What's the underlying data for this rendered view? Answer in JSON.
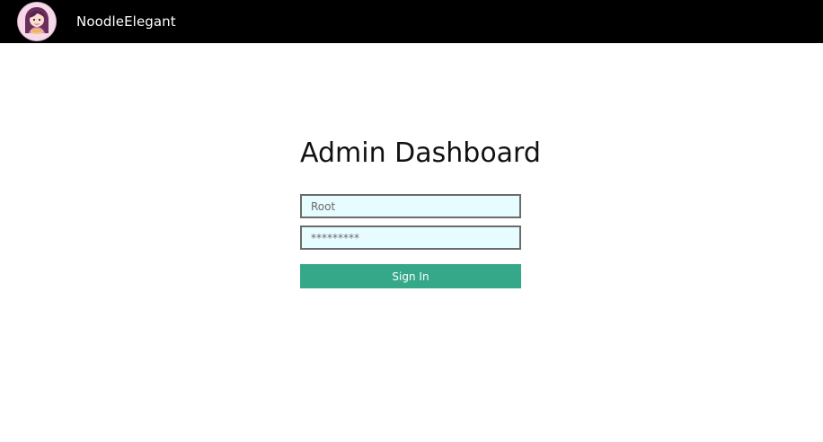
{
  "header": {
    "brand": "NoodleElegant",
    "logo_icon": "chef-avatar-logo-icon"
  },
  "main": {
    "title": "Admin Dashboard",
    "username": {
      "placeholder": "Root"
    },
    "password": {
      "placeholder": "*********"
    },
    "signin_label": "Sign In"
  },
  "colors": {
    "navbar_bg": "#000000",
    "input_bg": "#e6fcff",
    "button_bg": "#35a88a",
    "button_text": "#ffffff"
  }
}
